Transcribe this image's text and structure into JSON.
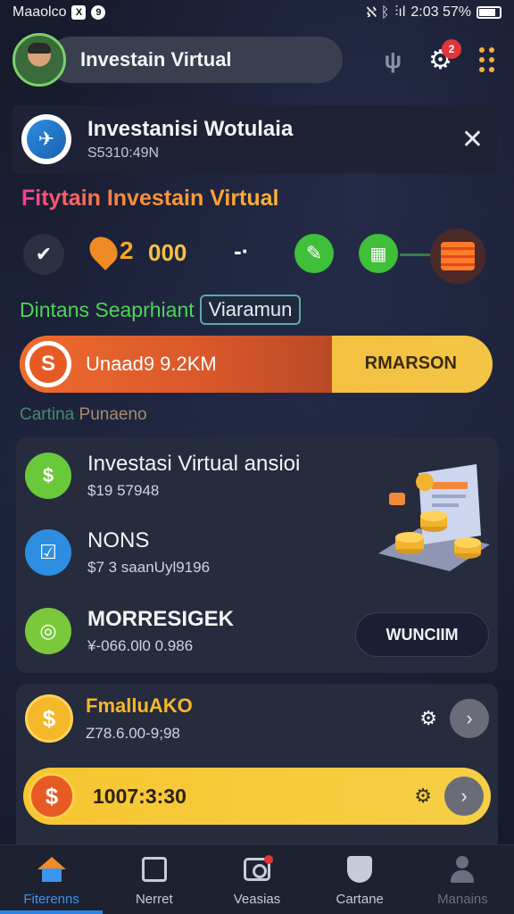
{
  "status_bar": {
    "carrier": "Maaolco",
    "badge_x": "X",
    "badge_circle": "9",
    "icons_text": "ℵ ᛒ",
    "signal": "⫶ıl",
    "time_battery": "2:03 57%"
  },
  "header": {
    "title": "Investain Virtual",
    "icon_glyph": "ψ",
    "notification_count": "2"
  },
  "banner": {
    "logo_glyph": "✈",
    "title": "Investanisi Wotulaia",
    "subtitle": "S5310:49N",
    "close": "✕"
  },
  "section_title": "Fitytain Investain Virtual",
  "icon_row": {
    "check": "✔",
    "coin_num": "2",
    "amount": "000",
    "dash": "-·",
    "green1": "✎",
    "green2": "▦"
  },
  "label_row": {
    "green_text": "Dintans Seaprhiant",
    "box_text": "Viaramun"
  },
  "progress": {
    "percent": 66,
    "coin": "S",
    "text": "Unaad9 9.2KM",
    "button": "RMARSON"
  },
  "subtle_label": {
    "part1": "Cartina",
    "part2": "Punaeno"
  },
  "list": [
    {
      "icon": "$",
      "icon_color": "#6ac93a",
      "title": "Investasi Virtual ansioi",
      "sub": "$19 57948",
      "bold": false
    },
    {
      "icon": "☑",
      "icon_color": "#2d8de0",
      "title": "NONS",
      "sub": "$7 3 saanUyl9196",
      "bold": false
    },
    {
      "icon": "◎",
      "icon_color": "#7ac93a",
      "title": "MORRESIGEK",
      "sub": "¥-066.0l0 0.986",
      "bold": true
    }
  ],
  "card1_button": "WUNCIIM",
  "card2": {
    "coin": "$",
    "title": "FmalluAKO",
    "sub": "Z78.6.00-9;98",
    "gear": "⚙",
    "arrow": "›",
    "bar_coin": "$",
    "bar_text": "1007:3:30"
  },
  "bottom_nav": [
    {
      "label": "Fiterenns",
      "icon": "home-icon",
      "active": true
    },
    {
      "label": "Nerret",
      "icon": "square-icon"
    },
    {
      "label": "Veasias",
      "icon": "camera-icon"
    },
    {
      "label": "Cartane",
      "icon": "shield-icon"
    },
    {
      "label": "Manains",
      "icon": "person-icon",
      "muted": true
    }
  ],
  "colors": {
    "background": "#15192a",
    "accent_orange": "#ee6a2f",
    "accent_yellow": "#f6c53a",
    "accent_green": "#4fd35a",
    "active_blue": "#3d95f0"
  }
}
